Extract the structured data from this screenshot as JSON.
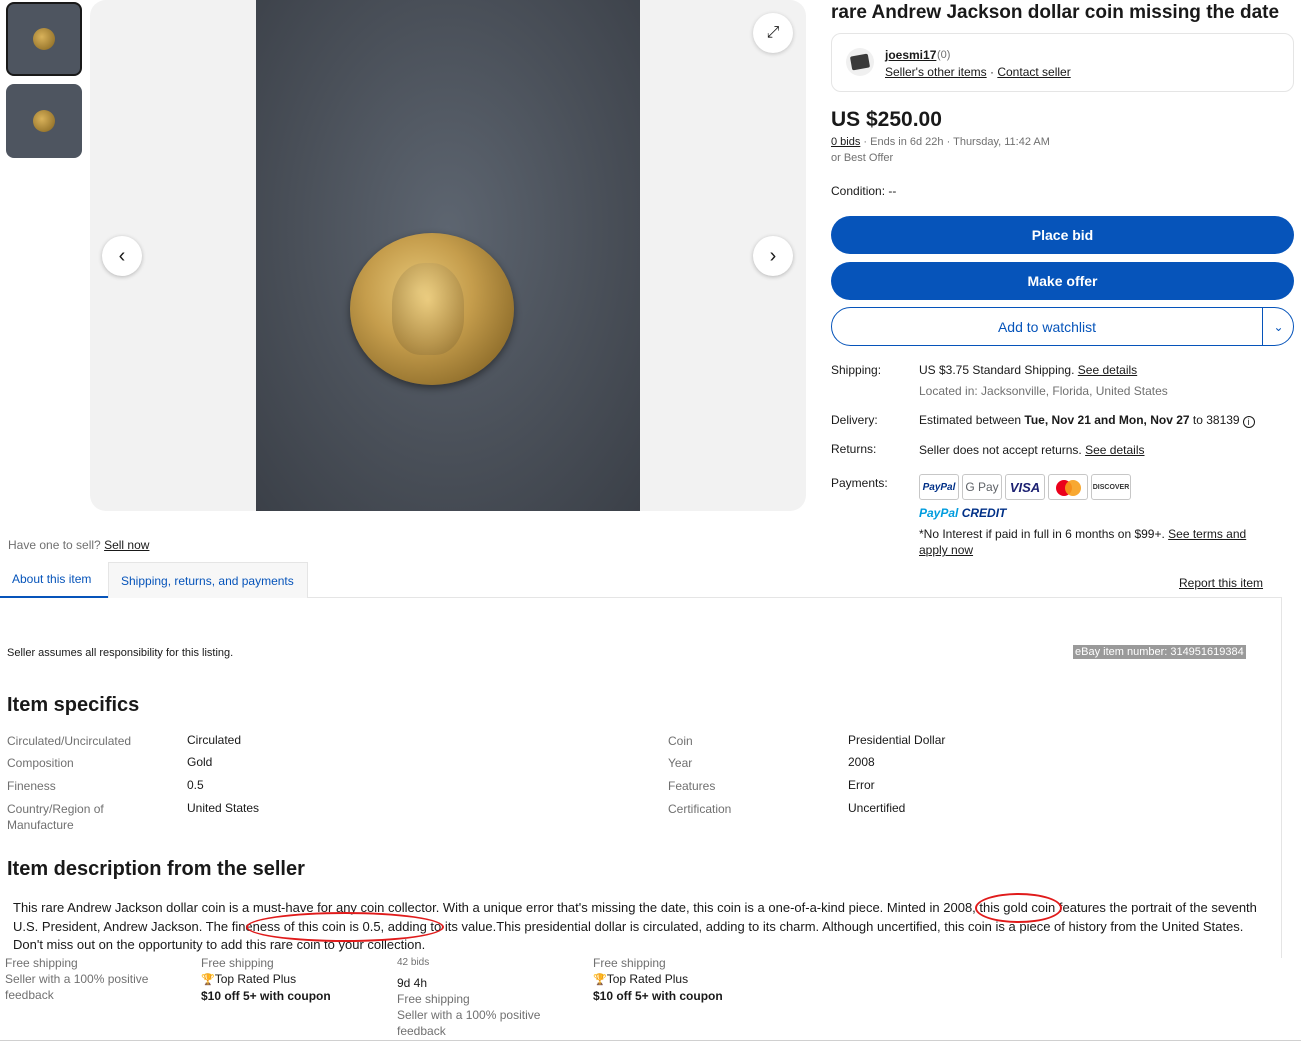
{
  "listing": {
    "title": "rare Andrew Jackson dollar coin missing the date",
    "price": "US $250.00",
    "bids": "0 bids",
    "ends": " · Ends in 6d 22h · Thursday, 11:42 AM",
    "best_offer": "or Best Offer",
    "condition": "Condition: --"
  },
  "seller": {
    "name": "joesmi17",
    "score": "(0)",
    "other_items": "Seller's other items",
    "separator": " · ",
    "contact": "Contact seller"
  },
  "actions": {
    "place_bid": "Place bid",
    "make_offer": "Make offer",
    "add_to_watchlist": "Add to watchlist"
  },
  "details": {
    "shipping_label": "Shipping:",
    "shipping_value": "US $3.75 Standard Shipping.",
    "shipping_link": "See details",
    "location": "Located in: Jacksonville, Florida, United States",
    "delivery_label": "Delivery:",
    "delivery_prefix": "Estimated between ",
    "delivery_dates": "Tue, Nov 21 and Mon, Nov 27",
    "delivery_suffix": " to 38139",
    "returns_label": "Returns:",
    "returns_value": "Seller does not accept returns.",
    "returns_link": "See details",
    "payments_label": "Payments:",
    "payment_methods": [
      "PayPal",
      "G Pay",
      "VISA",
      "",
      "DISCOVER"
    ],
    "paypal_credit_a": "PayPal",
    "paypal_credit_b": "CREDIT",
    "no_interest": "*No Interest if paid in full in 6 months on $99+.",
    "terms_link": "See terms and apply now"
  },
  "sell": {
    "prompt": "Have one to sell?",
    "link": "Sell now"
  },
  "tabs": {
    "about": "About this item",
    "shipping": "Shipping, returns, and payments",
    "report": "Report this item"
  },
  "about": {
    "responsibility": "Seller assumes all responsibility for this listing.",
    "item_number_label": "eBay item number:",
    "item_number": "314951619384"
  },
  "specifics": {
    "heading": "Item specifics",
    "left": [
      {
        "label": "Circulated/Uncirculated",
        "value": "Circulated"
      },
      {
        "label": "Composition",
        "value": "Gold"
      },
      {
        "label": "Fineness",
        "value": "0.5"
      },
      {
        "label": "Country/Region of Manufacture",
        "value": "United States"
      }
    ],
    "right": [
      {
        "label": "Coin",
        "value": "Presidential Dollar"
      },
      {
        "label": "Year",
        "value": "2008"
      },
      {
        "label": "Features",
        "value": "Error"
      },
      {
        "label": "Certification",
        "value": "Uncertified"
      }
    ]
  },
  "description": {
    "heading": "Item description from the seller",
    "text": "This rare Andrew Jackson dollar coin is a must-have for any coin collector. With a unique error that's missing the date, this coin is a one-of-a-kind piece. Minted in 2008, this gold coin features the portrait of the seventh U.S. President, Andrew Jackson. The fineness of this coin is 0.5, adding to its value.This presidential dollar is circulated, adding to its charm. Although uncertified, this coin is a piece of history from the United States. Don't miss out on the opportunity to add this rare coin to your collection."
  },
  "strip": [
    {
      "line1": "Free shipping",
      "line2": "Seller with a 100% positive",
      "line3": "feedback"
    },
    {
      "line1": "Free shipping",
      "line2": "Top Rated Plus",
      "line3": "$10 off 5+ with coupon"
    },
    {
      "line1": "42 bids",
      "line2": "9d 4h",
      "line3": "Free shipping",
      "line4": "Seller with a 100% positive",
      "line5": "feedback"
    },
    {
      "line1": "Free shipping",
      "line2": "Top Rated Plus",
      "line3": "$10 off 5+ with coupon"
    }
  ],
  "colors": {
    "primary": "#0654ba",
    "annotation": "#e01b1b"
  },
  "icons": [
    "chevron-left-icon",
    "chevron-right-icon",
    "expand-icon",
    "chevron-down-icon",
    "info-icon",
    "trophy-icon"
  ]
}
